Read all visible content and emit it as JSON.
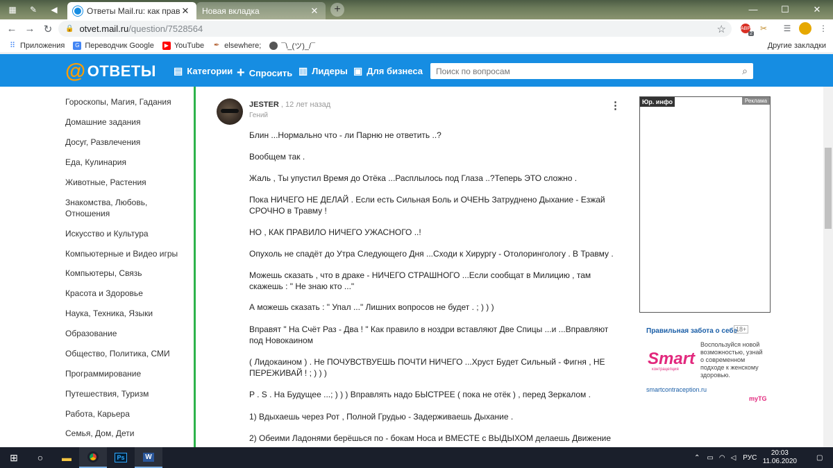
{
  "browser": {
    "tabs": [
      {
        "title": "Ответы Mail.ru: как правильно в",
        "active": true
      },
      {
        "title": "Новая вкладка",
        "active": false
      }
    ],
    "window_controls": {
      "minimize": "—",
      "maximize": "☐",
      "close": "✕"
    },
    "url_host": "otvet.mail.ru",
    "url_path": "/question/7528564",
    "extension_badge": "2",
    "bookmarks": [
      {
        "label": "Приложения",
        "icon": "apps-grid-icon"
      },
      {
        "label": "Переводчик Google",
        "icon": "google-translate-icon"
      },
      {
        "label": "YouTube",
        "icon": "youtube-icon"
      },
      {
        "label": "elsewhere;",
        "icon": "feather-icon"
      },
      {
        "label": "¯\\_(ツ)_/¯",
        "icon": "avatar-icon"
      }
    ],
    "other_bookmarks": "Другие закладки"
  },
  "site": {
    "logo": "ОТВЕТЫ",
    "nav": [
      {
        "label": "Категории",
        "icon": "list-icon"
      },
      {
        "label": "Спросить",
        "icon": "plus-icon"
      },
      {
        "label": "Лидеры",
        "icon": "bar-chart-icon"
      },
      {
        "label": "Для бизнеса",
        "icon": "briefcase-icon"
      }
    ],
    "search_placeholder": "Поиск по вопросам",
    "brand_color": "#168de2",
    "accent_color": "#2db34a"
  },
  "sidebar": {
    "categories": [
      "Гороскопы, Магия, Гадания",
      "Домашние задания",
      "Досуг, Развлечения",
      "Еда, Кулинария",
      "Животные, Растения",
      "Знакомства, Любовь, Отношения",
      "Искусство и Культура",
      "Компьютерные и Видео игры",
      "Компьютеры, Связь",
      "Красота и Здоровье",
      "Наука, Техника, Языки",
      "Образование",
      "Общество, Политика, СМИ",
      "Программирование",
      "Путешествия, Туризм",
      "Работа, Карьера",
      "Семья, Дом, Дети"
    ]
  },
  "answer": {
    "author": "JESTER",
    "time": ", 12 лет назад",
    "rank": "Гений",
    "paragraphs": [
      "Блин ...Нормально что - ли Парню не ответить ..?",
      "Вообщем так .",
      "Жаль , Ты упустил Время до Отёка ...Расплылось под Глаза ..?Теперь ЭТО сложно .",
      "Пока НИЧЕГО НЕ ДЕЛАЙ . Если есть Сильная Боль и ОЧЕНЬ Затруднено Дыхание - Езжай СРОЧНО в Травму !",
      "НО , КАК ПРАВИЛО НИЧЕГО УЖАСНОГО ..!",
      "Опухоль не спадёт до Утра Следующего Дня ...Сходи к Хирургу - Отолорингологу . В Травму .",
      "Можешь сказать , что в драке - НИЧЕГО СТРАШНОГО ...Если сообщат в Милицию , там скажешь : \" Не знаю кто ...\"",
      "А можешь сказать : \" Упал ...\" Лишних вопросов не будет . ; ) ) )",
      "Вправят \" На Счёт Раз - Два ! \" Как правило в ноздри вставляют Две Спицы ...и ...Вправляют под Новокаином",
      "( Лидокаином ) . Не ПОЧУВСТВУЕШЬ ПОЧТИ НИЧЕГО ...Хруст Будет Сильный - Фигня , НЕ ПЕРЕЖИВАЙ ! ; ) ) )",
      "P . S . На Будущее ...; ) ) ) Вправлять надо БЫСТРЕЕ ( пока не отёк ) , перед Зеркалом .",
      "1) Вдыхаешь через Рот , Полной Грудью - Задерживаешь Дыхание .",
      "2) Обеими Ладонями берёшься по - бокам Носа и ВМЕСТЕ с ВЫДЫХОМ делаешь Движение"
    ]
  },
  "ads": {
    "box_label": "Юр. инфо",
    "reklama": "Реклама",
    "promo_title": "Правильная забота о себе",
    "age": "18+",
    "brand": "Smart",
    "brand_sub": "контрацепция",
    "text": "Воспользуйся новой возможностью, узнай о современном подходе к женскому здоровью.",
    "url": "smartcontraception.ru",
    "network": "myTG"
  },
  "taskbar": {
    "language": "РУС",
    "time": "20:03",
    "date": "11.06.2020"
  }
}
